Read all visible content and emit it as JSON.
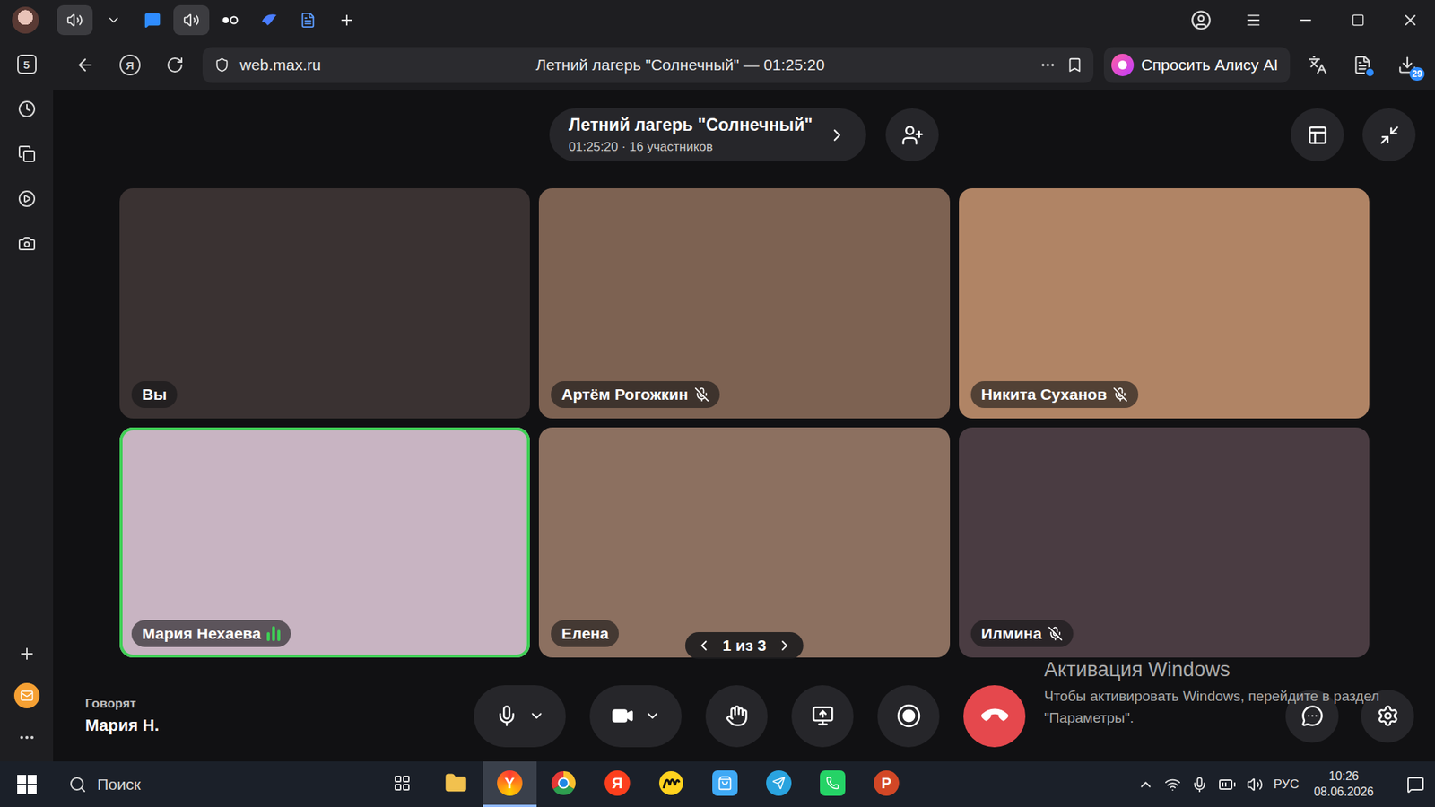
{
  "browser": {
    "tabs": [
      {
        "kind": "sound",
        "selected": true,
        "audible": true
      },
      {
        "kind": "chat",
        "selected": false,
        "audible": false
      },
      {
        "kind": "sound",
        "selected": false,
        "audible": true
      },
      {
        "kind": "dots",
        "selected": false,
        "audible": false
      },
      {
        "kind": "bird",
        "selected": false,
        "audible": false
      },
      {
        "kind": "doc",
        "selected": false,
        "audible": false
      }
    ],
    "yandex_glyph": "Я",
    "url": "web.max.ru",
    "page_title": "Летний лагерь \"Солнечный\" — 01:25:20",
    "alice": "Спросить Алису AI",
    "downloads_badge": "29",
    "sidebar_counter": "5"
  },
  "call": {
    "title": "Летний лагерь \"Солнечный\"",
    "subtitle": "01:25:20 · 16 участников",
    "pager": "1 из 3",
    "speaking_label": "Говорят",
    "speaking_name": "Мария Н."
  },
  "participants": [
    {
      "name": "Вы",
      "muted": false,
      "speaking": false,
      "level": 0,
      "color": "#3a3232"
    },
    {
      "name": "Артём Рогожкин",
      "muted": true,
      "speaking": false,
      "level": 0,
      "color": "#7d6252"
    },
    {
      "name": "Никита Суханов",
      "muted": true,
      "speaking": false,
      "level": 0,
      "color": "#b08465"
    },
    {
      "name": "Мария Нехаева",
      "muted": false,
      "speaking": true,
      "level": 0.8,
      "color": "#c8b4c2"
    },
    {
      "name": "Елена",
      "muted": false,
      "speaking": false,
      "level": 0,
      "color": "#8c7060"
    },
    {
      "name": "Илмина",
      "muted": true,
      "speaking": false,
      "level": 0,
      "color": "#4a3c42"
    }
  ],
  "watermark": {
    "title": "Активация Windows",
    "text": "Чтобы активировать Windows, перейдите в раздел \"Параметры\"."
  },
  "taskbar": {
    "search": "Поиск",
    "apps": [
      {
        "kind": "taskview",
        "active": false,
        "glyph": ""
      },
      {
        "kind": "folder",
        "active": false,
        "glyph": ""
      },
      {
        "kind": "yabrowser",
        "active": true,
        "glyph": "Y"
      },
      {
        "kind": "chrome",
        "active": false,
        "glyph": ""
      },
      {
        "kind": "yandex",
        "active": false,
        "glyph": "Я"
      },
      {
        "kind": "yellow",
        "active": false,
        "glyph": ""
      },
      {
        "kind": "store",
        "active": false,
        "glyph": ""
      },
      {
        "kind": "telegram",
        "active": false,
        "glyph": ""
      },
      {
        "kind": "whatsapp",
        "active": false,
        "glyph": ""
      },
      {
        "kind": "powerpoint",
        "active": false,
        "glyph": "P"
      }
    ],
    "lang": "РУС",
    "time": "10:26",
    "date": "08.06.2026"
  }
}
